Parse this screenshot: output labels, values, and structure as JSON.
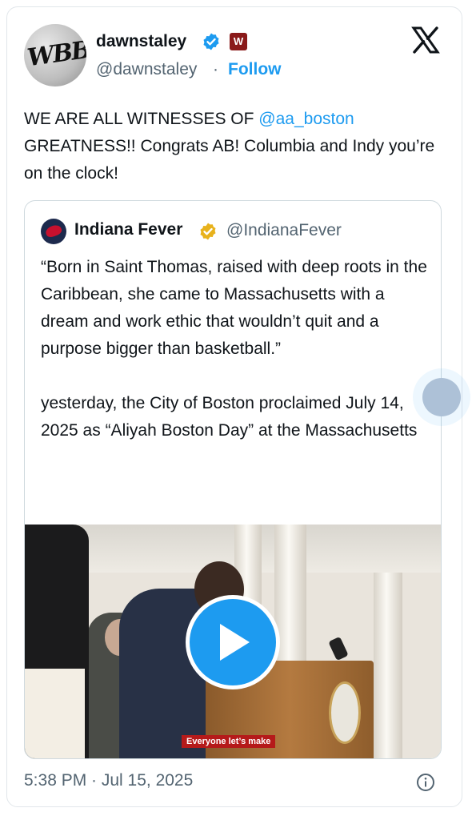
{
  "author": {
    "name": "dawnstaley",
    "handle": "@dawnstaley",
    "separator": "·",
    "follow_label": "Follow",
    "avatar_text": "WBB"
  },
  "tweet": {
    "text_before": "WE ARE ALL WITNESSES OF ",
    "mention": "@aa_boston",
    "text_after": " GREATNESS!!  Congrats AB!  Columbia and Indy you’re on the clock!"
  },
  "quoted": {
    "name": "Indiana Fever",
    "handle": "@IndianaFever",
    "paragraph1": "“Born in Saint Thomas, raised with deep roots in the Caribbean, she came to Massachusetts with a dream and work ethic that wouldn’t quit and a purpose bigger than basketball.”",
    "paragraph2": "yesterday, the City of Boston proclaimed July 14, 2025 as “Aliyah Boston Day” at the Massachusetts",
    "video_caption": "Everyone let’s make"
  },
  "timestamp": "5:38 PM · Jul 15, 2025",
  "colors": {
    "accent": "#1d9bf0",
    "text": "#0f1419",
    "muted": "#536471",
    "verified_gold": "#e8b21c"
  },
  "icons": [
    "verified-icon",
    "w-badge-icon",
    "x-logo-icon",
    "play-icon",
    "info-icon"
  ]
}
